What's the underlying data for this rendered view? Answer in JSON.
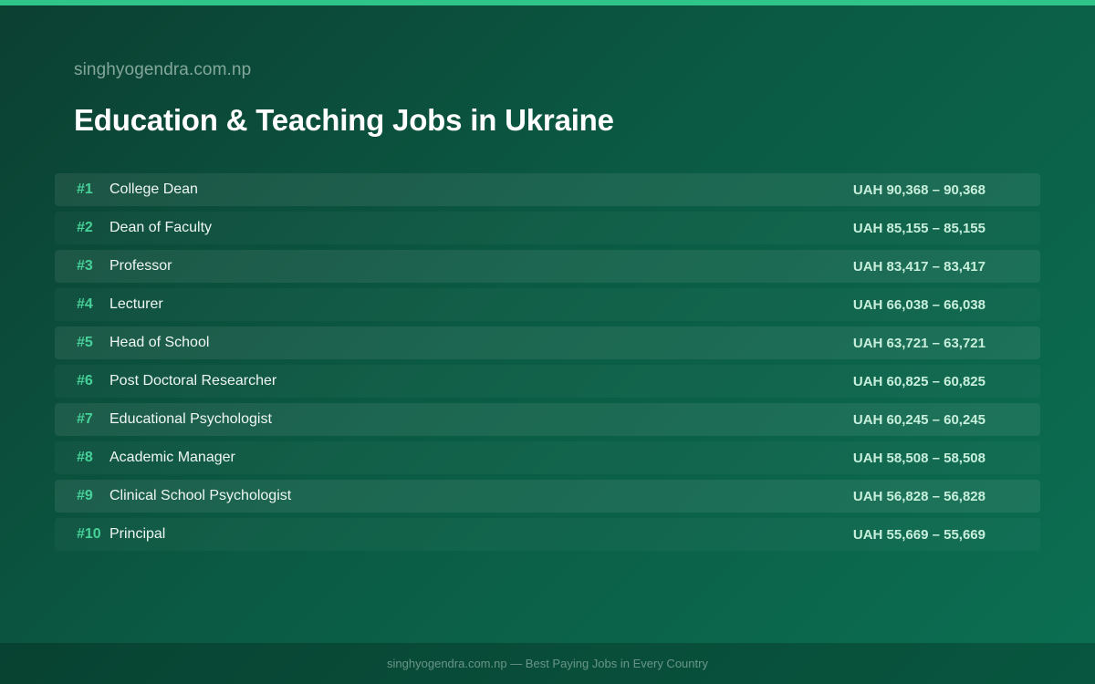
{
  "header": {
    "site": "singhyogendra.com.np",
    "title": "Education & Teaching Jobs in Ukraine"
  },
  "jobs": [
    {
      "rank": "#1",
      "title": "College Dean",
      "salary": "UAH 90,368 – 90,368"
    },
    {
      "rank": "#2",
      "title": "Dean of Faculty",
      "salary": "UAH 85,155 – 85,155"
    },
    {
      "rank": "#3",
      "title": "Professor",
      "salary": "UAH 83,417 – 83,417"
    },
    {
      "rank": "#4",
      "title": "Lecturer",
      "salary": "UAH 66,038 – 66,038"
    },
    {
      "rank": "#5",
      "title": "Head of School",
      "salary": "UAH 63,721 – 63,721"
    },
    {
      "rank": "#6",
      "title": "Post Doctoral Researcher",
      "salary": "UAH 60,825 – 60,825"
    },
    {
      "rank": "#7",
      "title": "Educational Psychologist",
      "salary": "UAH 60,245 – 60,245"
    },
    {
      "rank": "#8",
      "title": "Academic Manager",
      "salary": "UAH 58,508 – 58,508"
    },
    {
      "rank": "#9",
      "title": "Clinical School Psychologist",
      "salary": "UAH 56,828 – 56,828"
    },
    {
      "rank": "#10",
      "title": "Principal",
      "salary": "UAH 55,669 – 55,669"
    }
  ],
  "footer": {
    "text": "singhyogendra.com.np — Best Paying Jobs in Every Country"
  },
  "colors": {
    "accent": "#2fc58a",
    "rank": "#46d199",
    "background_start": "#0b3f31",
    "background_end": "#0b6f52"
  }
}
